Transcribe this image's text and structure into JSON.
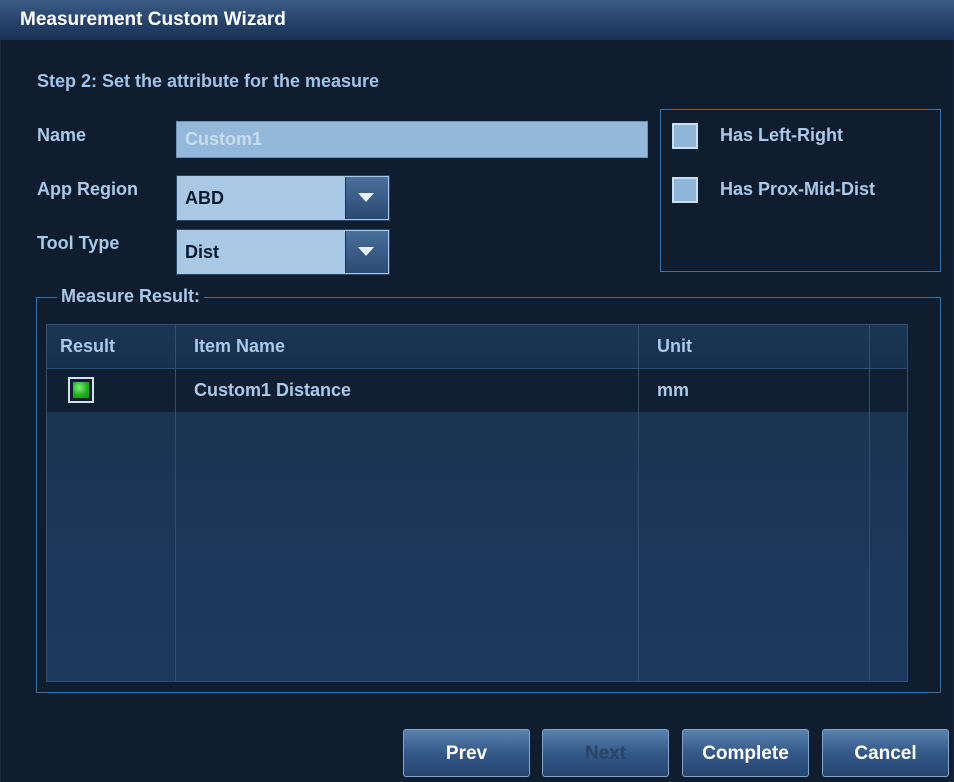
{
  "window": {
    "title": "Measurement Custom Wizard"
  },
  "step": {
    "heading": "Step 2: Set the attribute for the measure"
  },
  "form": {
    "name_label": "Name",
    "name_value": "Custom1",
    "app_region_label": "App Region",
    "app_region_value": "ABD",
    "tool_type_label": "Tool Type",
    "tool_type_value": "Dist"
  },
  "options": {
    "has_left_right": {
      "label": "Has Left-Right",
      "checked": false
    },
    "has_prox_mid_dist": {
      "label": "Has Prox-Mid-Dist",
      "checked": false
    }
  },
  "result_group": {
    "title": "Measure Result:",
    "columns": [
      "Result",
      "Item Name",
      "Unit"
    ],
    "rows": [
      {
        "checked": true,
        "item_name": "Custom1 Distance",
        "unit": "mm"
      }
    ]
  },
  "buttons": {
    "prev": "Prev",
    "next": "Next",
    "complete": "Complete",
    "cancel": "Cancel"
  },
  "colors": {
    "accent": "#3c6ea6",
    "text": "#a9c9ea",
    "background": "#0f1d2f",
    "checked_green": "#23b023"
  }
}
